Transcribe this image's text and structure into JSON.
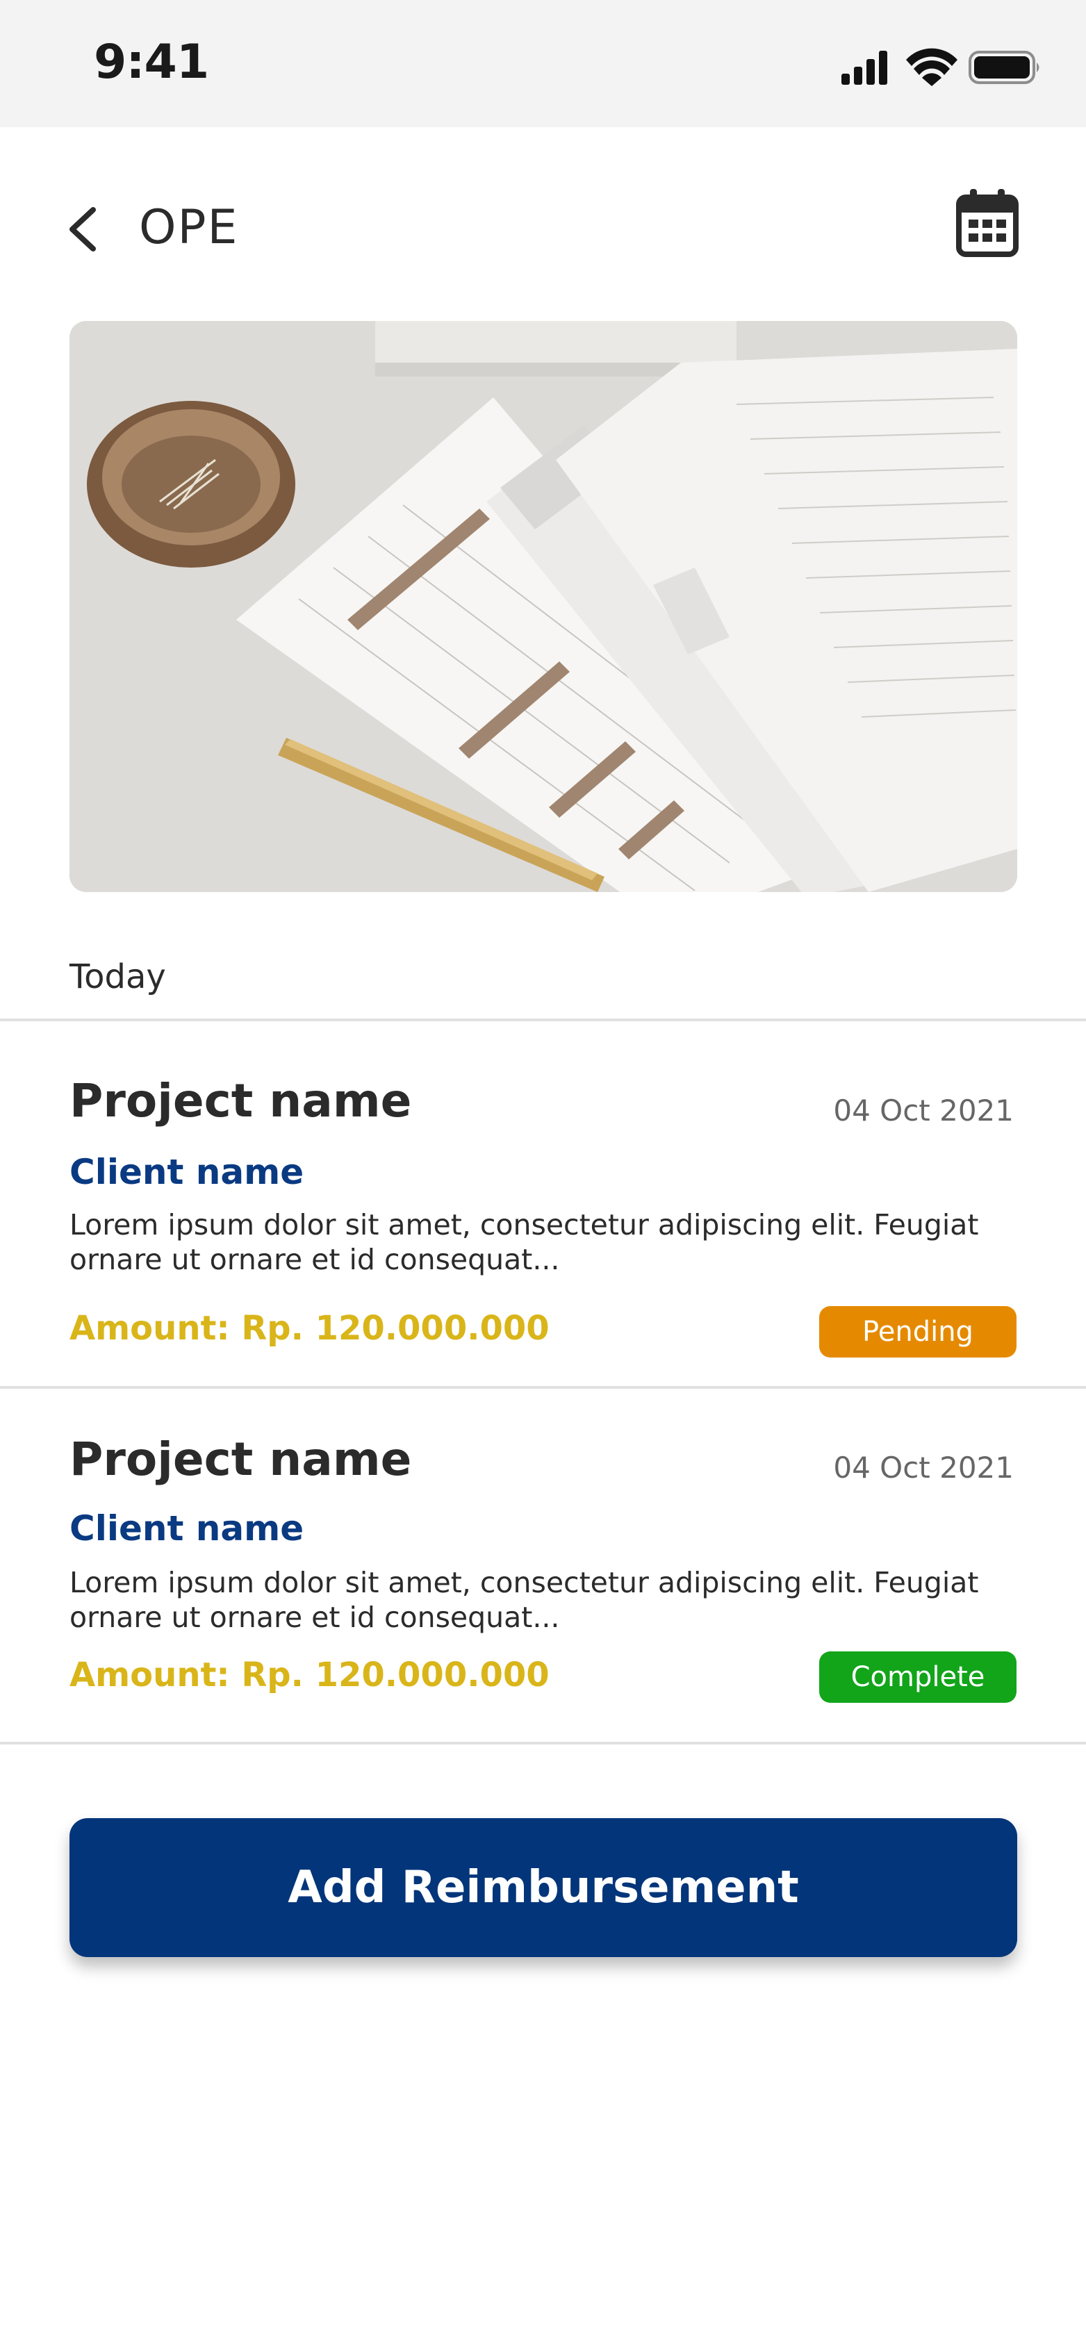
{
  "status_bar": {
    "time": "9:41"
  },
  "header": {
    "title": "OPE"
  },
  "section": {
    "label": "Today"
  },
  "cards": [
    {
      "project": "Project name",
      "date": "04 Oct 2021",
      "client": "Client name",
      "description": "Lorem ipsum dolor sit amet, consectetur adipiscing elit. Feugiat ornare ut ornare et id consequat...",
      "amount": "Amount: Rp. 120.000.000",
      "status": "Pending",
      "status_color": "#e58a00"
    },
    {
      "project": "Project name",
      "date": "04 Oct 2021",
      "client": "Client name",
      "description": "Lorem ipsum dolor sit amet, consectetur adipiscing elit. Feugiat ornare ut ornare et id consequat...",
      "amount": "Amount: Rp. 120.000.000",
      "status": "Complete",
      "status_color": "#12a51a"
    }
  ],
  "actions": {
    "add_label": "Add Reimbursement"
  },
  "colors": {
    "brand": "#03357a",
    "client_name": "#0a3a82",
    "amount": "#d9b51a"
  }
}
